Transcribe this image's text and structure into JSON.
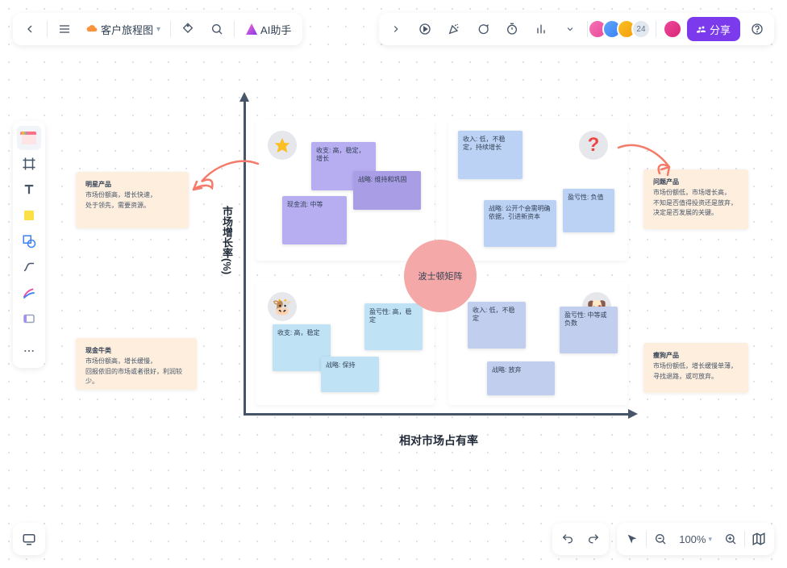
{
  "header": {
    "doc_title": "客户旅程图",
    "ai_label": "AI助手",
    "avatar_overflow": "24",
    "share_label": "分享"
  },
  "bottombar": {
    "zoom_label": "100%"
  },
  "chart_data": {
    "type": "matrix",
    "title": "波士顿矩阵",
    "xlabel": "相对市场占有率",
    "ylabel": "市场增长率(%)",
    "quadrants": {
      "top_left": {
        "icon": "star",
        "notes": [
          "收支: 高，稳定，增长",
          "战略: 维持和巩固",
          "现金流: 中等"
        ],
        "callout": {
          "title": "明星产品",
          "lines": [
            "市场份额高，增长快速，",
            "处于领先，需要资源。"
          ]
        }
      },
      "top_right": {
        "icon": "question",
        "notes": [
          "收入: 低，不稳定，持续增长",
          "战略: 公开个会需明确依据，引进新资本",
          "盈亏性: 负值"
        ],
        "callout": {
          "title": "问题产品",
          "lines": [
            "市场份额低，市场增长高，",
            "不知是否值得投资还是放弃，",
            "决定是否发展的关键。"
          ]
        }
      },
      "bottom_left": {
        "icon": "cow",
        "notes": [
          "收支: 高，稳定",
          "盈亏性: 高，稳定",
          "战略: 保持"
        ],
        "callout": {
          "title": "现金牛类",
          "lines": [
            "市场份额高，增长缓慢，",
            "回报依旧的市场或者很好，利润较少。"
          ]
        }
      },
      "bottom_right": {
        "icon": "dog",
        "notes": [
          "收入: 低，不稳定",
          "盈亏性: 中等或负数",
          "战略: 放弃"
        ],
        "callout": {
          "title": "瘦狗产品",
          "lines": [
            "市场份额低，增长缓慢单薄，",
            "寻找退路，或可放弃。"
          ]
        }
      }
    }
  }
}
